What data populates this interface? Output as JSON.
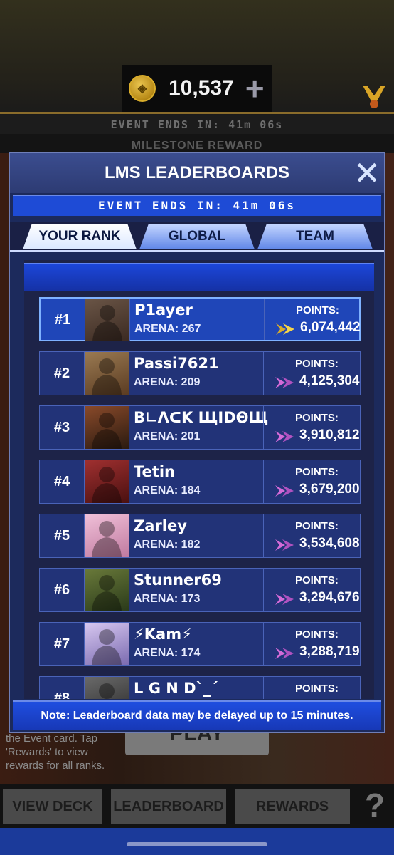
{
  "currency": {
    "amount": "10,537",
    "plus": "+"
  },
  "background": {
    "event_timer": "EVENT ENDS IN: 41m 06s",
    "milestone": "MILESTONE REWARD",
    "play": "PLAY",
    "hint": "the Event card. Tap 'Rewards' to view rewards for all ranks."
  },
  "bottom_nav": {
    "view_deck": "VIEW DECK",
    "leaderboard": "LEADERBOARD",
    "rewards": "REWARDS",
    "help": "?"
  },
  "modal": {
    "title": "LMS LEADERBOARDS",
    "close": "✕",
    "event_timer": "EVENT ENDS IN: 41m 06s",
    "tabs": [
      {
        "label": "YOUR RANK",
        "active": true
      },
      {
        "label": "GLOBAL",
        "active": false
      },
      {
        "label": "TEAM",
        "active": false
      }
    ],
    "points_label": "POINTS:",
    "note": "Note: Leaderboard data may be delayed up to 15 minutes."
  },
  "leaderboard": [
    {
      "rank": "#1",
      "name": "P1ayer",
      "arena": "ARENA: 267",
      "points": "6,074,442",
      "icon": "gold-chevron-icon",
      "me": true
    },
    {
      "rank": "#2",
      "name": "Passi7621",
      "arena": "ARENA: 209",
      "points": "4,125,304",
      "icon": "pink-chevron-icon",
      "me": false
    },
    {
      "rank": "#3",
      "name": "B∟ΛᑕK ЩIDΘЩ",
      "arena": "ARENA: 201",
      "points": "3,910,812",
      "icon": "pink-chevron-icon",
      "me": false
    },
    {
      "rank": "#4",
      "name": "Tetin",
      "arena": "ARENA: 184",
      "points": "3,679,200",
      "icon": "pink-chevron-icon",
      "me": false
    },
    {
      "rank": "#5",
      "name": "Zarley",
      "arena": "ARENA: 182",
      "points": "3,534,608",
      "icon": "pink-chevron-icon",
      "me": false
    },
    {
      "rank": "#6",
      "name": "Stunner69",
      "arena": "ARENA: 173",
      "points": "3,294,676",
      "icon": "pink-chevron-icon",
      "me": false
    },
    {
      "rank": "#7",
      "name": "⚡Kam⚡",
      "arena": "ARENA: 174",
      "points": "3,288,719",
      "icon": "pink-chevron-icon",
      "me": false
    },
    {
      "rank": "#8",
      "name": "L G N D`_´",
      "arena": "",
      "points": "",
      "icon": "pink-chevron-icon",
      "me": false
    }
  ],
  "colors": {
    "accent_blue": "#1e4bd6",
    "row_bg": "#223378",
    "gold": "#d9ad2b",
    "pink": "#d46bd8"
  }
}
